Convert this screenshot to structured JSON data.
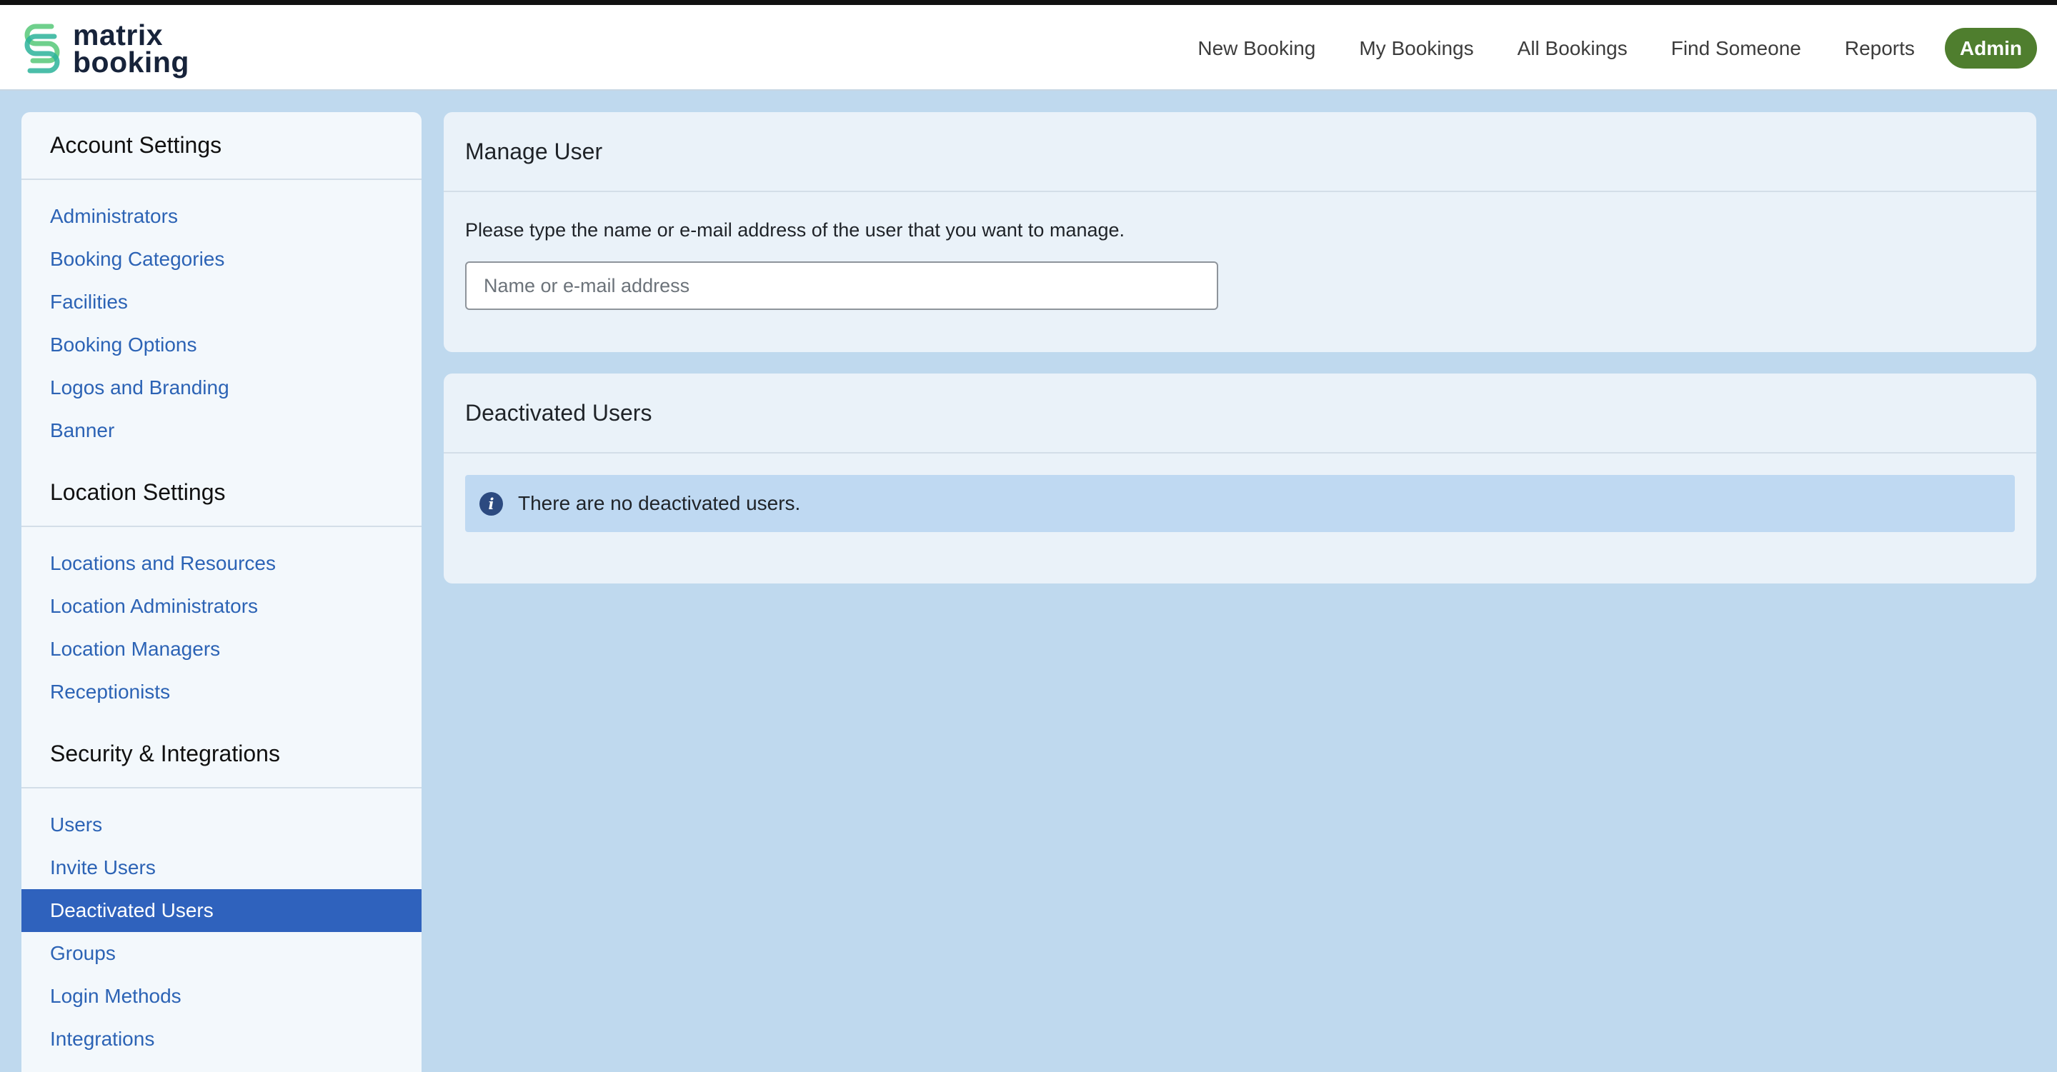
{
  "brand": {
    "line1": "matrix",
    "line2": "booking",
    "colors": {
      "green": "#6fd08c",
      "teal": "#2bb39a",
      "text": "#17233a"
    }
  },
  "nav": {
    "items": [
      "New Booking",
      "My Bookings",
      "All Bookings",
      "Find Someone",
      "Reports"
    ],
    "admin": "Admin",
    "admin_color": "#4f7e2e"
  },
  "sidebar": {
    "sections": [
      {
        "heading": "Account Settings",
        "items": [
          "Administrators",
          "Booking Categories",
          "Facilities",
          "Booking Options",
          "Logos and Branding",
          "Banner"
        ]
      },
      {
        "heading": "Location Settings",
        "items": [
          "Locations and Resources",
          "Location Administrators",
          "Location Managers",
          "Receptionists"
        ]
      },
      {
        "heading": "Security & Integrations",
        "items": [
          "Users",
          "Invite Users",
          "Deactivated Users",
          "Groups",
          "Login Methods",
          "Integrations"
        ]
      }
    ],
    "active_item": "Deactivated Users",
    "active_color": "#2f62bd"
  },
  "manage_user": {
    "title": "Manage User",
    "instruction": "Please type the name or e-mail address of the user that you want to manage.",
    "search_placeholder": "Name or e-mail address",
    "search_value": ""
  },
  "deactivated": {
    "title": "Deactivated Users",
    "message": "There are no deactivated users.",
    "icon": "info-icon"
  }
}
